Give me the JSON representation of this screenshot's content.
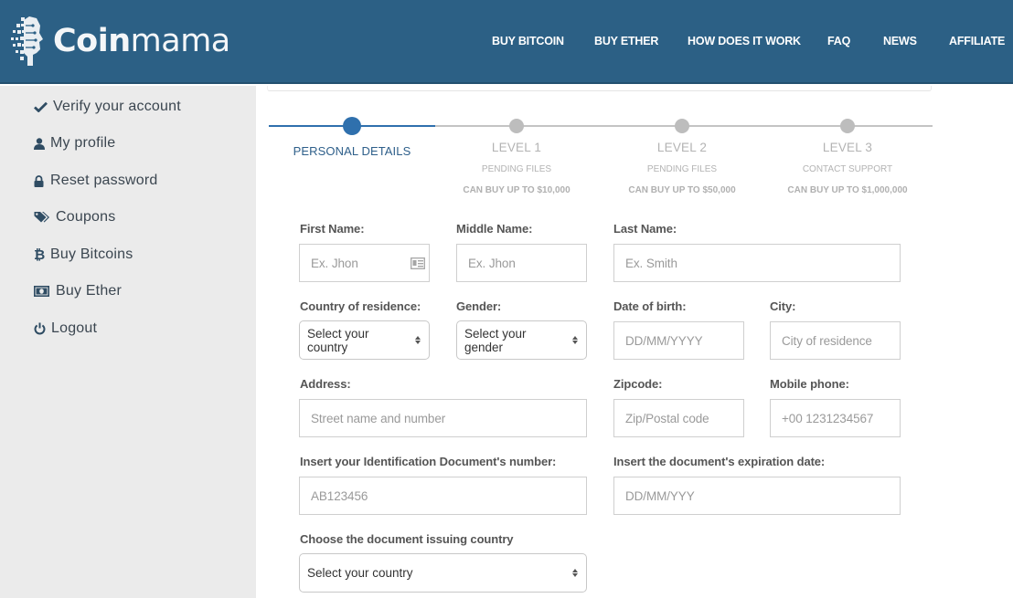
{
  "header": {
    "brand_bold": "Coin",
    "brand_light": "mama",
    "background": "#2c6085",
    "nav": [
      "BUY BITCOIN",
      "BUY ETHER",
      "HOW DOES IT WORK",
      "FAQ",
      "NEWS",
      "AFFILIATE"
    ]
  },
  "sidebar": {
    "items": [
      {
        "label": "Verify your account",
        "icon": "check-icon"
      },
      {
        "label": "My profile",
        "icon": "user-icon"
      },
      {
        "label": "Reset password",
        "icon": "lock-icon"
      },
      {
        "label": "Coupons",
        "icon": "tags-icon"
      },
      {
        "label": "Buy Bitcoins",
        "icon": "bitcoin-icon"
      },
      {
        "label": "Buy Ether",
        "icon": "money-icon"
      },
      {
        "label": "Logout",
        "icon": "power-icon"
      }
    ]
  },
  "steps": [
    {
      "title": "PERSONAL DETAILS",
      "sub": "",
      "limit": "",
      "active": true
    },
    {
      "title": "LEVEL 1",
      "sub": "PENDING FILES",
      "limit": "CAN BUY UP TO $10,000",
      "active": false
    },
    {
      "title": "LEVEL 2",
      "sub": "PENDING FILES",
      "limit": "CAN BUY UP TO $50,000",
      "active": false
    },
    {
      "title": "LEVEL 3",
      "sub": "CONTACT SUPPORT",
      "limit": "CAN BUY UP TO $1,000,000",
      "active": false
    }
  ],
  "form": {
    "first_name": {
      "label": "First Name:",
      "placeholder": "Ex. Jhon"
    },
    "middle_name": {
      "label": "Middle Name:",
      "placeholder": "Ex. Jhon"
    },
    "last_name": {
      "label": "Last Name:",
      "placeholder": "Ex. Smith"
    },
    "country": {
      "label": "Country of residence:",
      "value": "Select your country"
    },
    "gender": {
      "label": "Gender:",
      "value": "Select your gender"
    },
    "dob": {
      "label": "Date of birth:",
      "placeholder": "DD/MM/YYYY"
    },
    "city": {
      "label": "City:",
      "placeholder": "City of residence"
    },
    "address": {
      "label": "Address:",
      "placeholder": "Street name and number"
    },
    "zipcode": {
      "label": "Zipcode:",
      "placeholder": "Zip/Postal code"
    },
    "mobile": {
      "label": "Mobile phone:",
      "placeholder": "+00 1231234567"
    },
    "id_number": {
      "label": "Insert your Identification Document's number:",
      "placeholder": "AB123456"
    },
    "id_expiry": {
      "label": "Insert the document's expiration date:",
      "placeholder": "DD/MM/YYY"
    },
    "issuing_country": {
      "label": "Choose the document issuing country",
      "value": "Select your country"
    }
  }
}
